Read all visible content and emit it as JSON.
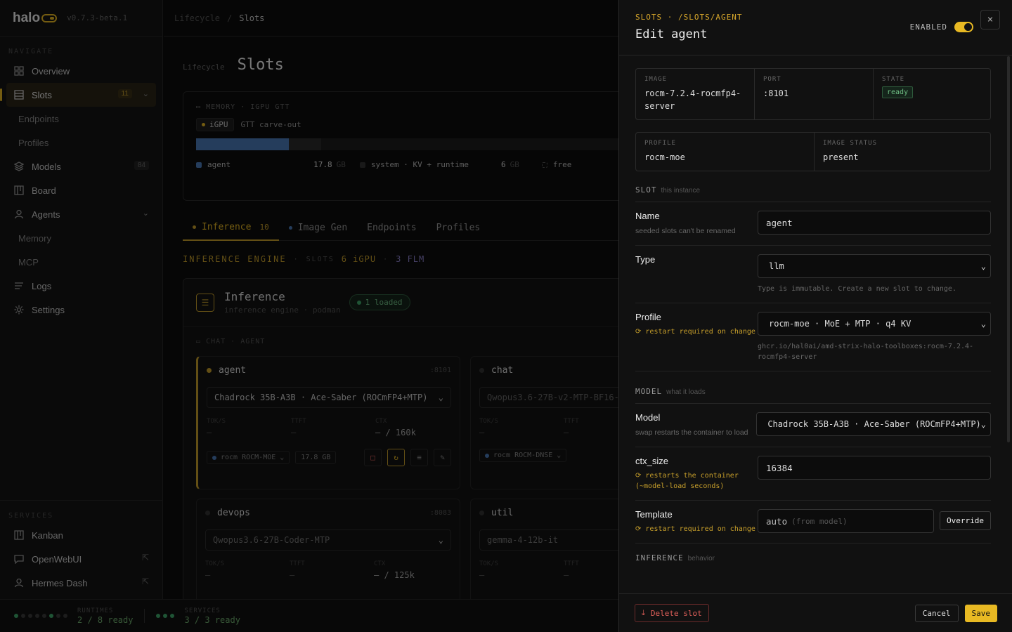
{
  "app": {
    "logo": "halo",
    "version": "v0.7.3-beta.1"
  },
  "sidebar": {
    "section_label": "NAVIGATE",
    "items": [
      {
        "label": "Overview"
      },
      {
        "label": "Slots",
        "badge": "11"
      },
      {
        "label": "Endpoints"
      },
      {
        "label": "Profiles"
      },
      {
        "label": "Models",
        "badge": "84"
      },
      {
        "label": "Board"
      },
      {
        "label": "Agents"
      },
      {
        "label": "Memory"
      },
      {
        "label": "MCP"
      },
      {
        "label": "Logs"
      },
      {
        "label": "Settings"
      }
    ],
    "services_label": "SERVICES",
    "services": [
      {
        "label": "Kanban"
      },
      {
        "label": "OpenWebUI"
      },
      {
        "label": "Hermes Dash"
      }
    ]
  },
  "footer": {
    "runtimes_label": "RUNTIMES",
    "runtimes_value": "2 / 8 ready",
    "services_label": "SERVICES",
    "services_value": "3 / 3 ready"
  },
  "breadcrumb": {
    "parent": "Lifecycle",
    "sep": "/",
    "current": "Slots"
  },
  "page": {
    "eyebrow": "Lifecycle",
    "title": "Slots"
  },
  "memory": {
    "label": "MEMORY · IGPU GTT",
    "chip": "iGPU",
    "chip_desc": "GTT carve-out",
    "agent_fraction": 0.22,
    "legend": [
      {
        "name": "agent",
        "value": "17.8",
        "unit": "GB"
      },
      {
        "name": "system · KV + runtime",
        "value": "6",
        "unit": "GB"
      },
      {
        "name": "free"
      }
    ]
  },
  "tabs": [
    {
      "label": "Inference",
      "count": "10"
    },
    {
      "label": "Image Gen"
    },
    {
      "label": "Endpoints"
    },
    {
      "label": "Profiles"
    }
  ],
  "engine": {
    "title": "INFERENCE ENGINE",
    "slots_label": "SLOTS",
    "igpu": "6 iGPU",
    "flm": "3 FLM"
  },
  "inference_card": {
    "title": "Inference",
    "subtitle": "inference engine · podman",
    "loaded": "1 loaded",
    "group_label": "CHAT · AGENT"
  },
  "slot_cards": [
    {
      "name": "agent",
      "port": ":8101",
      "model": "Chadrock 35B-A3B · Ace-Saber (ROCmFP4+MTP)",
      "m1": "TOK/S",
      "m1v": "—",
      "m2": "TTFT",
      "m2v": "—",
      "m3": "CTX",
      "m3v": "— / 160k",
      "backend": "rocm",
      "profile": "ROCM-MOE",
      "size": "17.8 GB"
    },
    {
      "name": "chat",
      "model": "Qwopus3.6-27B-v2-MTP-BF16-t",
      "m1": "TOK/S",
      "m1v": "—",
      "m2": "TTFT",
      "m2v": "—",
      "backend": "rocm",
      "profile": "ROCM-DNSE"
    },
    {
      "name": "devops",
      "port": ":8083",
      "model": "Qwopus3.6-27B-Coder-MTP",
      "m1": "TOK/S",
      "m1v": "—",
      "m2": "TTFT",
      "m2v": "—",
      "m3": "CTX",
      "m3v": "— / 125k"
    },
    {
      "name": "util",
      "model": "gemma-4-12b-it",
      "m1": "TOK/S",
      "m1v": "—",
      "m2": "TTFT",
      "m2v": "—"
    }
  ],
  "drawer": {
    "path": "SLOTS · /SLOTS/AGENT",
    "title": "Edit agent",
    "enabled_label": "ENABLED",
    "close": "×",
    "info": {
      "image_label": "IMAGE",
      "image": "rocm-7.2.4-rocmfp4-server",
      "port_label": "PORT",
      "port": ":8101",
      "state_label": "STATE",
      "state": "ready",
      "profile_label": "PROFILE",
      "profile": "rocm-moe",
      "image_status_label": "IMAGE STATUS",
      "image_status": "present"
    },
    "slot_section": "SLOT",
    "slot_sub": "this instance",
    "name_label": "Name",
    "name_hint": "seeded slots can't be renamed",
    "name_value": "agent",
    "type_label": "Type",
    "type_value": "llm",
    "type_hint": "Type is immutable. Create a new slot to change.",
    "profile_label": "Profile",
    "profile_warn": "⟳ restart required on change",
    "profile_value": "rocm-moe · MoE + MTP · q4 KV",
    "profile_hint": "ghcr.io/hal0ai/amd-strix-halo-toolboxes:rocm-7.2.4-rocmfp4-server",
    "model_section": "MODEL",
    "model_sub": "what it loads",
    "model_label": "Model",
    "model_hint": "swap restarts the container to load",
    "model_value": "Chadrock 35B-A3B · Ace-Saber (ROCmFP4+MTP)",
    "ctx_label": "ctx_size",
    "ctx_warn": "⟳ restarts the container (~model-load seconds)",
    "ctx_value": "16384",
    "template_label": "Template",
    "template_warn": "⟳ restart required on change",
    "template_value": "auto",
    "template_placeholder": "(from model)",
    "override": "Override",
    "inference_section": "INFERENCE",
    "inference_sub": "behavior",
    "delete": "Delete slot",
    "cancel": "Cancel",
    "save": "Save"
  },
  "colors": {
    "accent": "#e8b923",
    "ready": "#3fa86a",
    "danger": "#e0605a",
    "agent_bar": "#4a7bb8"
  }
}
